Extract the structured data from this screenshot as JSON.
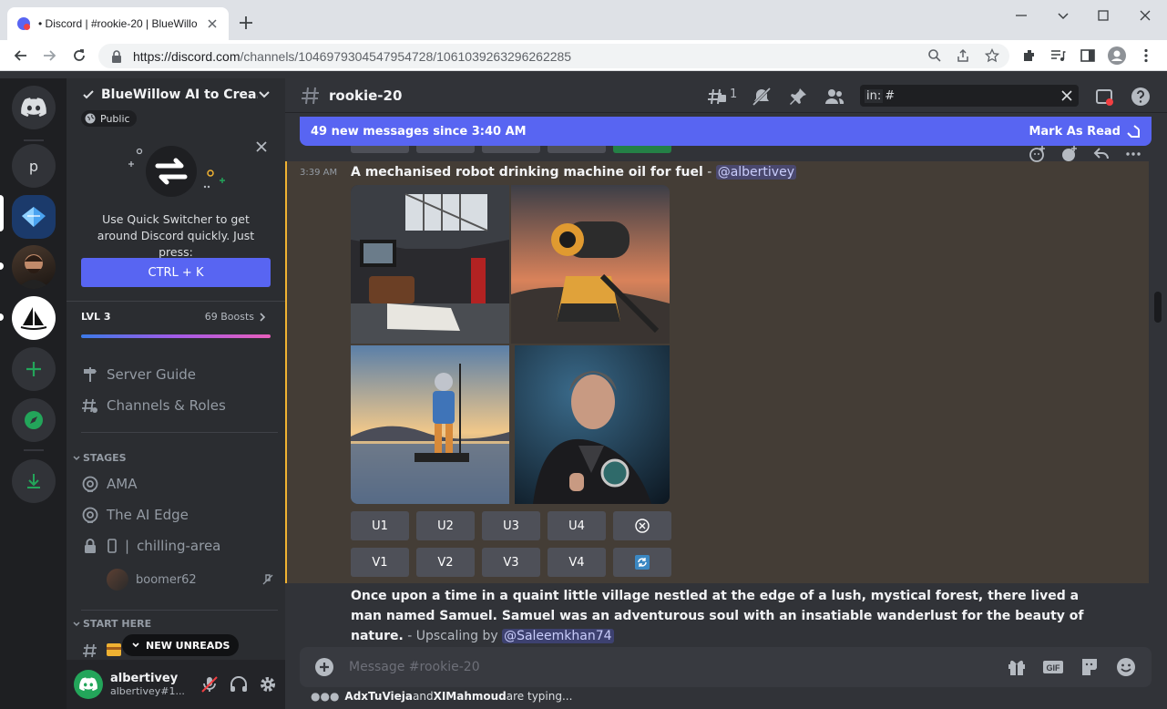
{
  "browser": {
    "tab_title": "• Discord | #rookie-20 | BlueWillo",
    "url_host": "https://discord.com",
    "url_path": "/channels/1046979304547954728/1061039263296262285"
  },
  "server": {
    "name": "BlueWillow AI to Crea...",
    "visibility": "Public",
    "guild_letter": "p",
    "quick_switcher_text": "Use Quick Switcher to get around Discord quickly. Just press:",
    "quick_switcher_key": "CTRL + K",
    "level": "LVL 3",
    "boosts": "69 Boosts",
    "progress": 0.98
  },
  "sidebar": {
    "server_guide": "Server Guide",
    "channels_roles": "Channels & Roles",
    "stages_category": "STAGES",
    "stage_channels": [
      "AMA",
      "The AI Edge",
      "chilling-area"
    ],
    "voice_user": "boomer62",
    "start_here_category": "START HERE",
    "new_unreads": "NEW UNREADS"
  },
  "user": {
    "name": "albertivey",
    "tag": "albertivey#1..."
  },
  "channel": {
    "name": "rookie-20",
    "threads_count": "1",
    "search_token": "in:",
    "search_value": "#"
  },
  "messages": {
    "new_banner": "49 new messages since 3:40 AM",
    "mark_read": "Mark As Read",
    "timestamp": "3:39 AM",
    "prompt": "A mechanised robot drinking machine oil for fuel",
    "separator": " - ",
    "mention": "@albertivey",
    "upscale_buttons": [
      "U1",
      "U2",
      "U3",
      "U4"
    ],
    "variation_buttons": [
      "V1",
      "V2",
      "V3",
      "V4"
    ],
    "story": "Once upon a time in a quaint little village nestled at the edge of a lush, mystical forest, there lived a man named Samuel. Samuel was an adventurous soul with an insatiable wanderlust for the beauty of nature.",
    "story_suffix": " - Upscaling by ",
    "story_mention": "@Saleemkhan74"
  },
  "composer": {
    "placeholder": "Message #rookie-20"
  },
  "typing": {
    "user1": "AdxTuVieja",
    "joiner": " and ",
    "user2": "XIMahmoud",
    "suffix": " are typing..."
  },
  "colors": {
    "blurple": "#5865f2",
    "green": "#23a55a",
    "highlight": "#443d36",
    "mention_border": "#f0b232"
  }
}
